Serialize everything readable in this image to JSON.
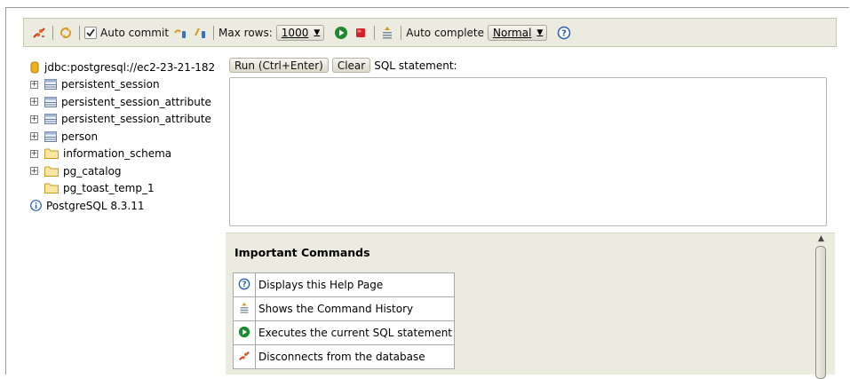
{
  "toolbar": {
    "auto_commit_label": "Auto commit",
    "max_rows_label": "Max rows:",
    "max_rows_value": "1000",
    "auto_complete_label": "Auto complete",
    "auto_complete_value": "Normal"
  },
  "tree": {
    "connection": "jdbc:postgresql://ec2-23-21-182",
    "items": [
      {
        "label": "persistent_session",
        "icon": "table-icon",
        "expandable": true
      },
      {
        "label": "persistent_session_attribute",
        "icon": "table-icon",
        "expandable": true
      },
      {
        "label": "persistent_session_attribute",
        "icon": "table-icon",
        "expandable": true
      },
      {
        "label": "person",
        "icon": "table-icon",
        "expandable": true
      },
      {
        "label": "information_schema",
        "icon": "folder-icon",
        "expandable": true
      },
      {
        "label": "pg_catalog",
        "icon": "folder-icon",
        "expandable": true
      },
      {
        "label": "pg_toast_temp_1",
        "icon": "folder-icon",
        "expandable": false
      }
    ],
    "version": "PostgreSQL 8.3.11"
  },
  "editor": {
    "run_label": "Run (Ctrl+Enter)",
    "clear_label": "Clear",
    "sql_label": "SQL statement:",
    "sql_value": ""
  },
  "help": {
    "title": "Important Commands",
    "commands": [
      {
        "icon": "help-icon",
        "text": "Displays this Help Page"
      },
      {
        "icon": "history-icon",
        "text": "Shows the Command History"
      },
      {
        "icon": "run-icon",
        "text": "Executes the current SQL statement"
      },
      {
        "icon": "disconnect-icon",
        "text": "Disconnects from the database"
      }
    ]
  },
  "colors": {
    "toolbar_bg": "#ecebdf",
    "run_green": "#1e8a2e",
    "stop_red": "#d8202a",
    "help_blue": "#2a5fb0"
  }
}
